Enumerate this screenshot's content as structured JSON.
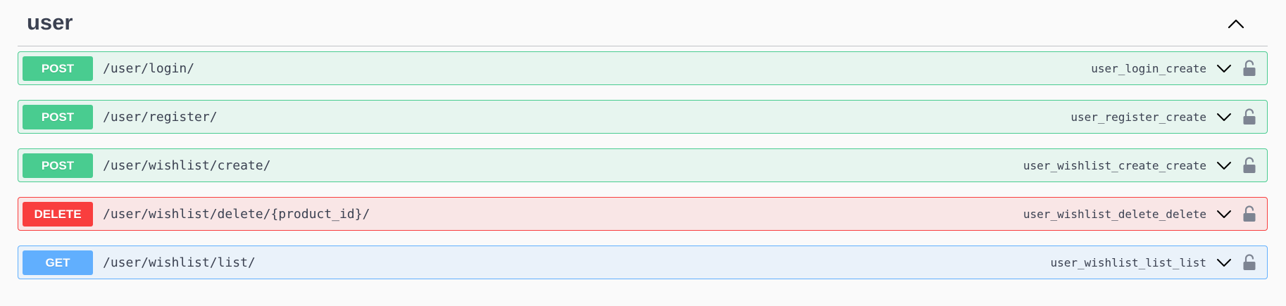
{
  "tag": {
    "title": "user"
  },
  "colors": {
    "post": "#49cc90",
    "delete": "#f93e3e",
    "get": "#61affe",
    "text": "#3b4151",
    "lock": "#7d8492"
  },
  "operations": [
    {
      "method": "POST",
      "path": "/user/login/",
      "operation_id": "user_login_create"
    },
    {
      "method": "POST",
      "path": "/user/register/",
      "operation_id": "user_register_create"
    },
    {
      "method": "POST",
      "path": "/user/wishlist/create/",
      "operation_id": "user_wishlist_create_create"
    },
    {
      "method": "DELETE",
      "path": "/user/wishlist/delete/{product_id}/",
      "operation_id": "user_wishlist_delete_delete"
    },
    {
      "method": "GET",
      "path": "/user/wishlist/list/",
      "operation_id": "user_wishlist_list_list"
    }
  ]
}
